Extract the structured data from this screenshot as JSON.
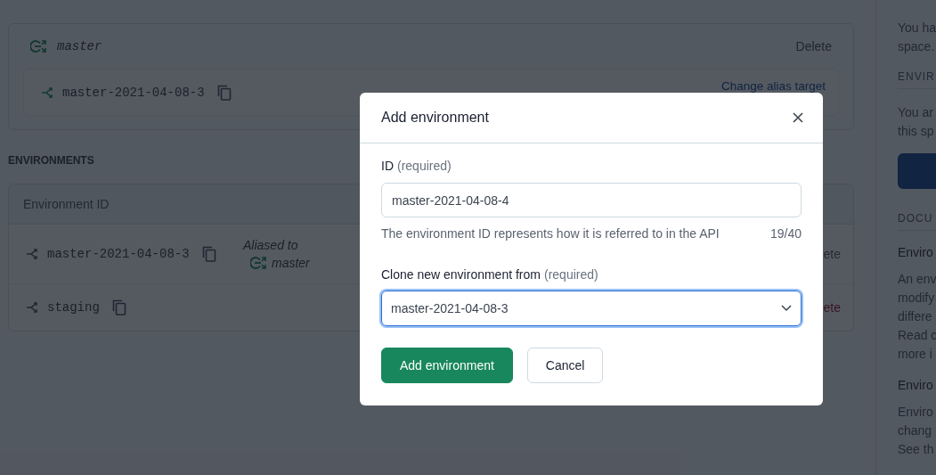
{
  "alias_card": {
    "alias": "master",
    "delete_label": "Delete",
    "target": {
      "id": "master-2021-04-08-3",
      "change_label": "Change alias target"
    }
  },
  "environments": {
    "heading": "ENVIRONMENTS",
    "columns": [
      "Environment ID"
    ],
    "rows": [
      {
        "id": "master-2021-04-08-3",
        "alias_note": "Aliased to",
        "alias": "master",
        "delete_label": "ete",
        "disabled": true
      },
      {
        "id": "staging",
        "delete_label": "ete",
        "disabled": false
      }
    ]
  },
  "sidebar": [
    {
      "kind": "text",
      "lines": [
        "You ha",
        "space."
      ]
    },
    {
      "kind": "heading",
      "text": "ENVIR"
    },
    {
      "kind": "text",
      "lines": [
        "You ar",
        "this sp"
      ]
    },
    {
      "kind": "button"
    },
    {
      "kind": "heading",
      "text": "DOCU"
    },
    {
      "kind": "title",
      "text": "Enviro"
    },
    {
      "kind": "text",
      "lines": [
        "An env",
        "modify",
        "differe",
        "Read c",
        "more i"
      ]
    },
    {
      "kind": "title",
      "text": "Enviro"
    },
    {
      "kind": "text",
      "lines": [
        "Enviro",
        "chang",
        "See th"
      ]
    }
  ],
  "modal": {
    "title": "Add environment",
    "id_field": {
      "label": "ID",
      "hint": "(required)",
      "value": "master-2021-04-08-4",
      "help": "The environment ID represents how it is referred to in the API",
      "counter": "19/40"
    },
    "clone_field": {
      "label": "Clone new environment from",
      "hint": "(required)",
      "value": "master-2021-04-08-3",
      "focused": true
    },
    "buttons": [
      {
        "label": "Add environment",
        "primary": true
      },
      {
        "label": "Cancel",
        "primary": false
      }
    ]
  }
}
